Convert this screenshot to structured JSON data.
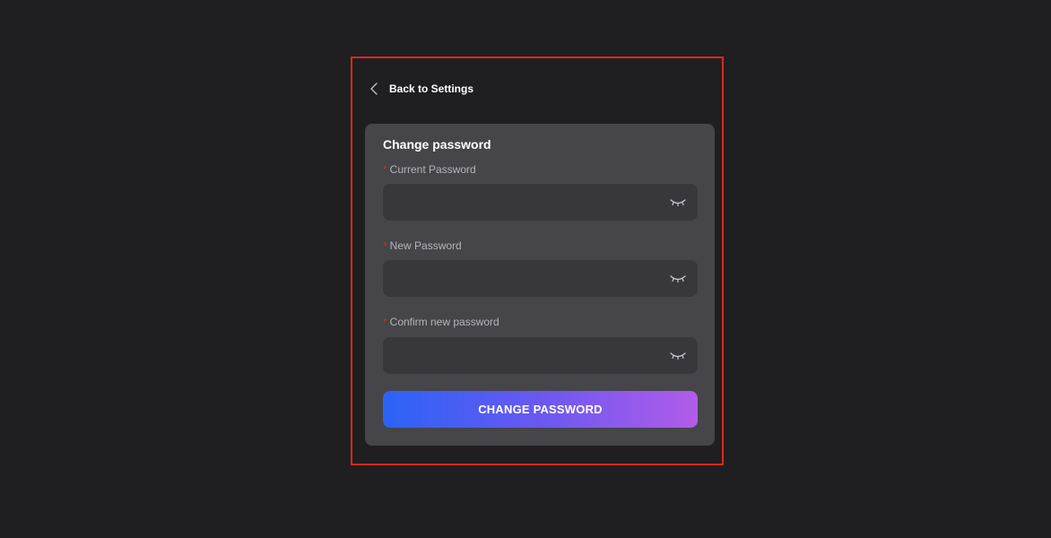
{
  "back_link": {
    "label": "Back to Settings",
    "icon": "chevron-left-icon"
  },
  "form": {
    "title": "Change password",
    "required_marker": "*",
    "fields": [
      {
        "label": "Current Password",
        "value": "",
        "icon": "eye-closed-icon"
      },
      {
        "label": "New Password",
        "value": "",
        "icon": "eye-closed-icon"
      },
      {
        "label": "Confirm new password",
        "value": "",
        "icon": "eye-closed-icon"
      }
    ],
    "submit_label": "CHANGE PASSWORD"
  },
  "colors": {
    "page_bg": "#1f1f21",
    "card_bg": "#45454a",
    "input_bg": "#37373c",
    "highlight_border": "#e0281c",
    "required": "#e0281c",
    "button_gradient_start": "#2a63f6",
    "button_gradient_end": "#b15ce8"
  }
}
